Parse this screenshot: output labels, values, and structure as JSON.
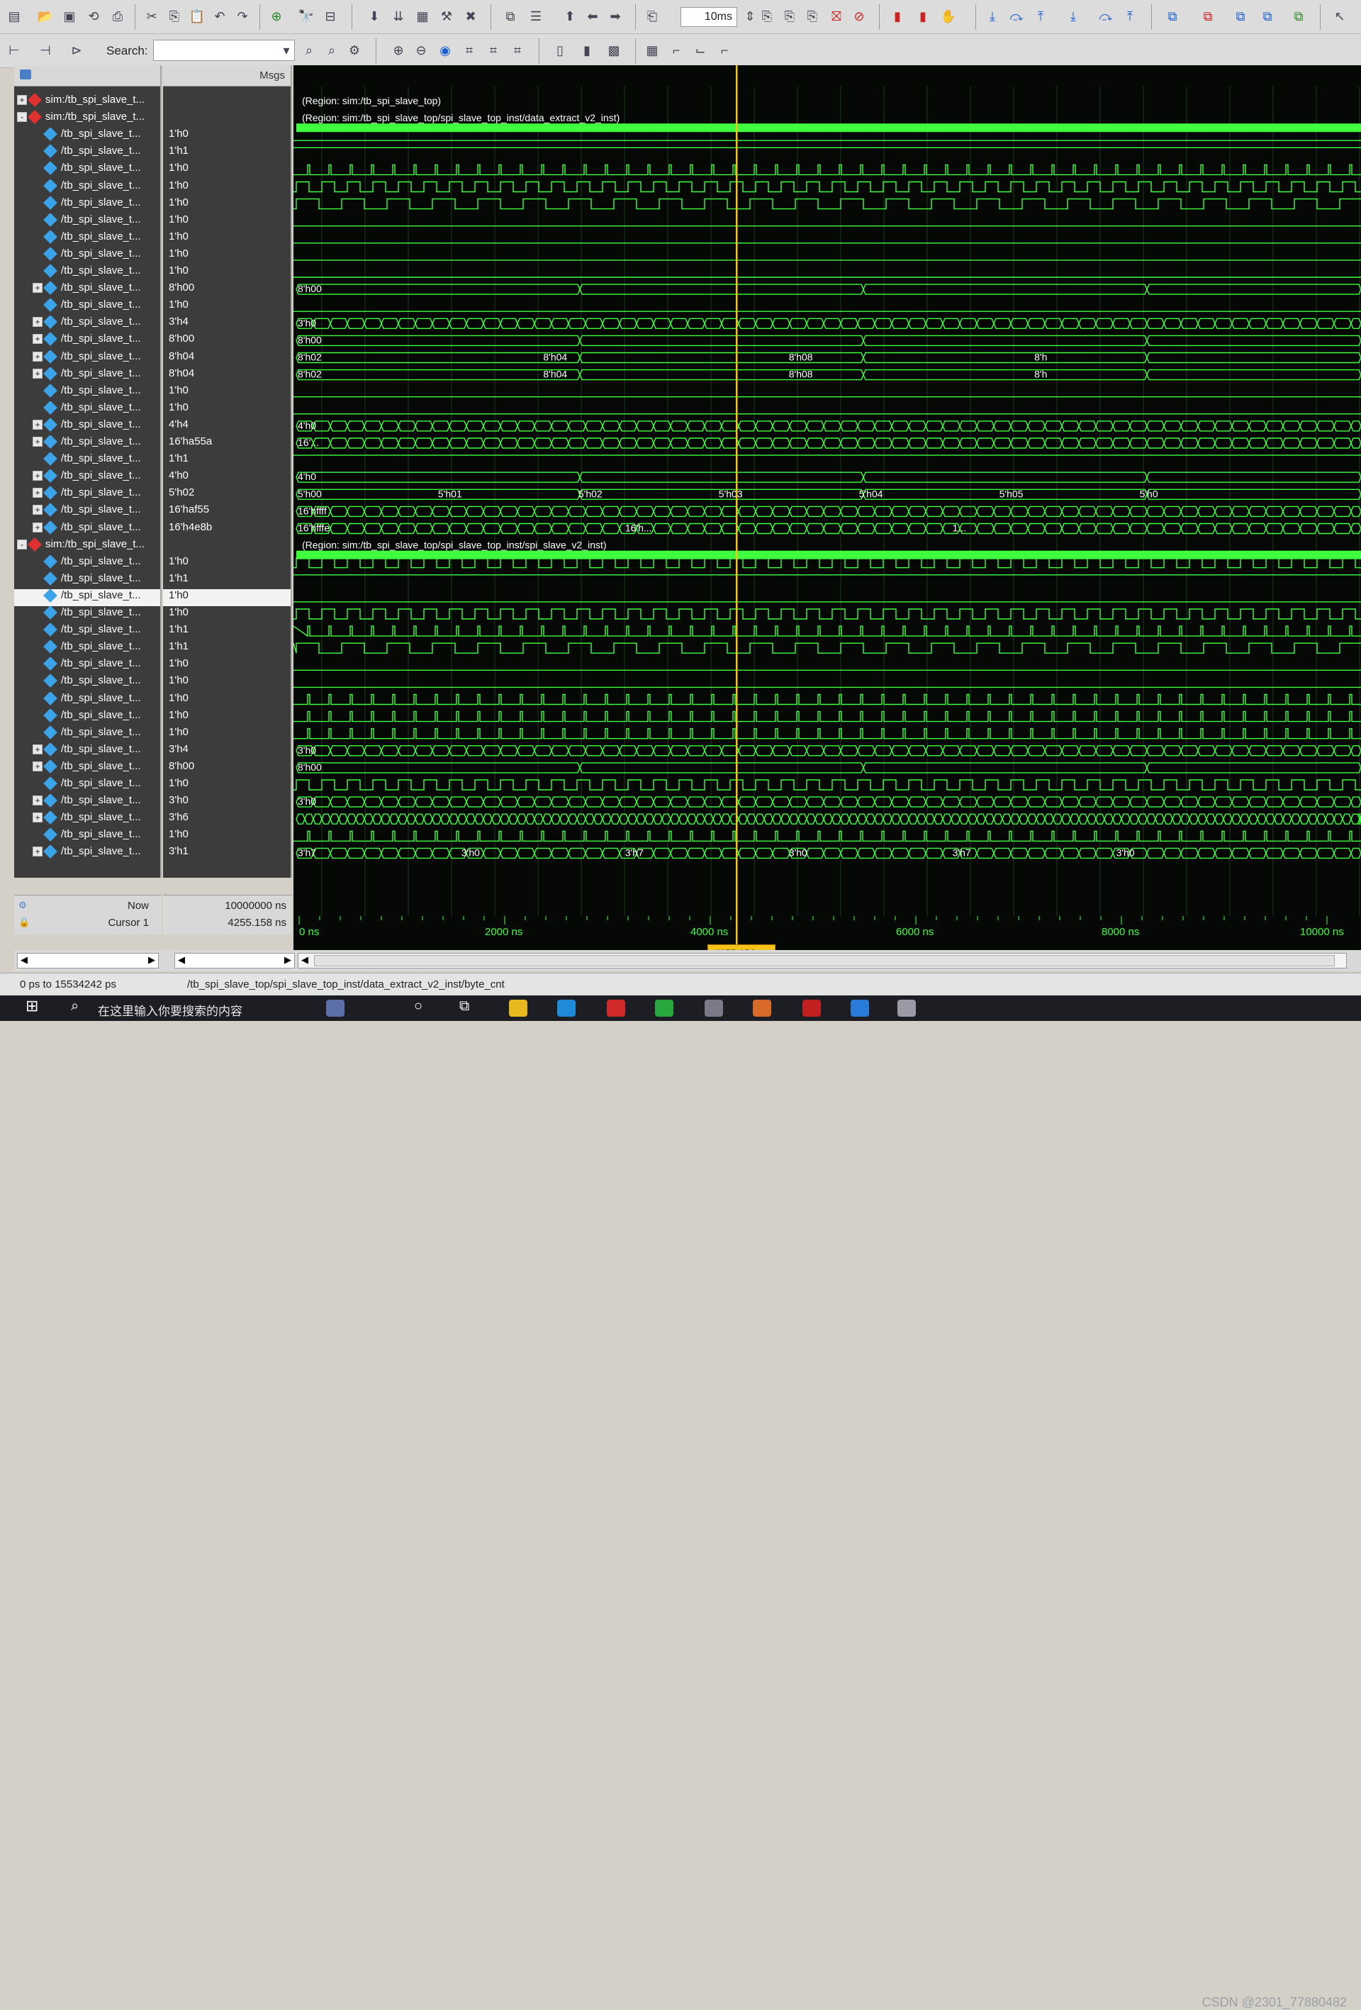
{
  "toolbar": {
    "search_label": "Search:",
    "search_value": "",
    "zoom_value": "10ms"
  },
  "panes": {
    "msgs_header": "Msgs"
  },
  "signals": [
    {
      "name": "sim:/tb_spi_slave_t...",
      "value": "",
      "kind": "region",
      "expander": "+"
    },
    {
      "name": "sim:/tb_spi_slave_t...",
      "value": "",
      "kind": "region",
      "expander": "-"
    },
    {
      "name": "/tb_spi_slave_t...",
      "value": "1'h0",
      "kind": "signal",
      "expander": ""
    },
    {
      "name": "/tb_spi_slave_t...",
      "value": "1'h1",
      "kind": "signal",
      "expander": ""
    },
    {
      "name": "/tb_spi_slave_t...",
      "value": "1'h0",
      "kind": "signal",
      "expander": ""
    },
    {
      "name": "/tb_spi_slave_t...",
      "value": "1'h0",
      "kind": "signal",
      "expander": ""
    },
    {
      "name": "/tb_spi_slave_t...",
      "value": "1'h0",
      "kind": "signal",
      "expander": ""
    },
    {
      "name": "/tb_spi_slave_t...",
      "value": "1'h0",
      "kind": "signal",
      "expander": ""
    },
    {
      "name": "/tb_spi_slave_t...",
      "value": "1'h0",
      "kind": "signal",
      "expander": ""
    },
    {
      "name": "/tb_spi_slave_t...",
      "value": "1'h0",
      "kind": "signal",
      "expander": ""
    },
    {
      "name": "/tb_spi_slave_t...",
      "value": "1'h0",
      "kind": "signal",
      "expander": ""
    },
    {
      "name": "/tb_spi_slave_t...",
      "value": "8'h00",
      "kind": "signal",
      "expander": "+"
    },
    {
      "name": "/tb_spi_slave_t...",
      "value": "1'h0",
      "kind": "signal",
      "expander": ""
    },
    {
      "name": "/tb_spi_slave_t...",
      "value": "3'h4",
      "kind": "signal",
      "expander": "+"
    },
    {
      "name": "/tb_spi_slave_t...",
      "value": "8'h00",
      "kind": "signal",
      "expander": "+"
    },
    {
      "name": "/tb_spi_slave_t...",
      "value": "8'h04",
      "kind": "signal",
      "expander": "+"
    },
    {
      "name": "/tb_spi_slave_t...",
      "value": "8'h04",
      "kind": "signal",
      "expander": "+"
    },
    {
      "name": "/tb_spi_slave_t...",
      "value": "1'h0",
      "kind": "signal",
      "expander": ""
    },
    {
      "name": "/tb_spi_slave_t...",
      "value": "1'h0",
      "kind": "signal",
      "expander": ""
    },
    {
      "name": "/tb_spi_slave_t...",
      "value": "4'h4",
      "kind": "signal",
      "expander": "+"
    },
    {
      "name": "/tb_spi_slave_t...",
      "value": "16'ha55a",
      "kind": "signal",
      "expander": "+"
    },
    {
      "name": "/tb_spi_slave_t...",
      "value": "1'h1",
      "kind": "signal",
      "expander": ""
    },
    {
      "name": "/tb_spi_slave_t...",
      "value": "4'h0",
      "kind": "signal",
      "expander": "+"
    },
    {
      "name": "/tb_spi_slave_t...",
      "value": "5'h02",
      "kind": "signal",
      "expander": "+"
    },
    {
      "name": "/tb_spi_slave_t...",
      "value": "16'haf55",
      "kind": "signal",
      "expander": "+"
    },
    {
      "name": "/tb_spi_slave_t...",
      "value": "16'h4e8b",
      "kind": "signal",
      "expander": "+"
    },
    {
      "name": "sim:/tb_spi_slave_t...",
      "value": "",
      "kind": "region",
      "expander": "-"
    },
    {
      "name": "/tb_spi_slave_t...",
      "value": "1'h0",
      "kind": "signal",
      "expander": ""
    },
    {
      "name": "/tb_spi_slave_t...",
      "value": "1'h1",
      "kind": "signal",
      "expander": ""
    },
    {
      "name": "/tb_spi_slave_t...",
      "value": "1'h0",
      "kind": "signal",
      "expander": "",
      "selected": true
    },
    {
      "name": "/tb_spi_slave_t...",
      "value": "1'h0",
      "kind": "signal",
      "expander": ""
    },
    {
      "name": "/tb_spi_slave_t...",
      "value": "1'h1",
      "kind": "signal",
      "expander": ""
    },
    {
      "name": "/tb_spi_slave_t...",
      "value": "1'h1",
      "kind": "signal",
      "expander": ""
    },
    {
      "name": "/tb_spi_slave_t...",
      "value": "1'h0",
      "kind": "signal",
      "expander": ""
    },
    {
      "name": "/tb_spi_slave_t...",
      "value": "1'h0",
      "kind": "signal",
      "expander": ""
    },
    {
      "name": "/tb_spi_slave_t...",
      "value": "1'h0",
      "kind": "signal",
      "expander": ""
    },
    {
      "name": "/tb_spi_slave_t...",
      "value": "1'h0",
      "kind": "signal",
      "expander": ""
    },
    {
      "name": "/tb_spi_slave_t...",
      "value": "1'h0",
      "kind": "signal",
      "expander": ""
    },
    {
      "name": "/tb_spi_slave_t...",
      "value": "3'h4",
      "kind": "signal",
      "expander": "+"
    },
    {
      "name": "/tb_spi_slave_t...",
      "value": "8'h00",
      "kind": "signal",
      "expander": "+"
    },
    {
      "name": "/tb_spi_slave_t...",
      "value": "1'h0",
      "kind": "signal",
      "expander": ""
    },
    {
      "name": "/tb_spi_slave_t...",
      "value": "3'h0",
      "kind": "signal",
      "expander": "+"
    },
    {
      "name": "/tb_spi_slave_t...",
      "value": "3'h6",
      "kind": "signal",
      "expander": "+"
    },
    {
      "name": "/tb_spi_slave_t...",
      "value": "1'h0",
      "kind": "signal",
      "expander": ""
    },
    {
      "name": "/tb_spi_slave_t...",
      "value": "3'h1",
      "kind": "signal",
      "expander": "+"
    }
  ],
  "regions": {
    "top": "(Region: sim:/tb_spi_slave_top)",
    "extract": "(Region: sim:/tb_spi_slave_top/spi_slave_top_inst/data_extract_v2_inst)",
    "slave": "(Region: sim:/tb_spi_slave_top/spi_slave_top_inst/spi_slave_v2_inst)"
  },
  "bus_labels": [
    {
      "row": 11,
      "items": [
        "8'h00"
      ]
    },
    {
      "row": 13,
      "items": [
        "3'h0"
      ]
    },
    {
      "row": 14,
      "items": [
        "8'h00"
      ]
    },
    {
      "row": 15,
      "items": [
        "8'h02",
        "8'h04",
        "8'h08",
        "8'h"
      ]
    },
    {
      "row": 16,
      "items": [
        "8'h02",
        "8'h04",
        "8'h08",
        "8'h"
      ]
    },
    {
      "row": 19,
      "items": [
        "4'h0"
      ]
    },
    {
      "row": 20,
      "items": [
        "16'..."
      ]
    },
    {
      "row": 22,
      "items": [
        "4'h0"
      ]
    },
    {
      "row": 23,
      "items": [
        "5'h00",
        "5'h01",
        "5'h02",
        "5'h03",
        "5'h04",
        "5'h05",
        "5'h0"
      ]
    },
    {
      "row": 24,
      "items": [
        "16'hffff"
      ]
    },
    {
      "row": 25,
      "items": [
        "16'hfffe",
        "16'h...",
        "1..."
      ]
    },
    {
      "row": 38,
      "items": [
        "3'h0"
      ]
    },
    {
      "row": 39,
      "items": [
        "8'h00"
      ]
    },
    {
      "row": 41,
      "items": [
        "3'h0"
      ]
    },
    {
      "row": 44,
      "items": [
        "3'h7",
        "3'h0",
        "3'h7",
        "3'h0",
        "3'h7",
        "3'h0"
      ]
    }
  ],
  "footer": {
    "now_label": "Now",
    "now_value": "10000000 ns",
    "cursor_label": "Cursor 1",
    "cursor_value": "4255.158 ns",
    "cursor_flag": "4255.158 ns"
  },
  "timeline": {
    "ticks": [
      "0 ns",
      "2000 ns",
      "4000 ns",
      "6000 ns",
      "8000 ns",
      "10000 ns"
    ]
  },
  "status": {
    "range": "0 ps to 15534242 ps",
    "path": "/tb_spi_slave_top/spi_slave_top_inst/data_extract_v2_inst/byte_cnt"
  },
  "taskbar": {
    "search_placeholder": "在这里输入你要搜索的内容"
  },
  "watermark": "CSDN @2301_77880482",
  "colors": {
    "wave": "#3fff3f",
    "cursor": "#f7c21a",
    "wave_bg": "#050805"
  },
  "icons": [
    "new-icon",
    "open-icon",
    "save-icon",
    "print-icon",
    "cut-icon",
    "copy-icon",
    "paste-icon",
    "undo-icon",
    "redo-icon",
    "add-icon",
    "find-icon",
    "zoom-in-icon",
    "zoom-out-icon",
    "zoom-full-icon",
    "step-icon",
    "run-icon",
    "stop-icon",
    "break-icon"
  ]
}
